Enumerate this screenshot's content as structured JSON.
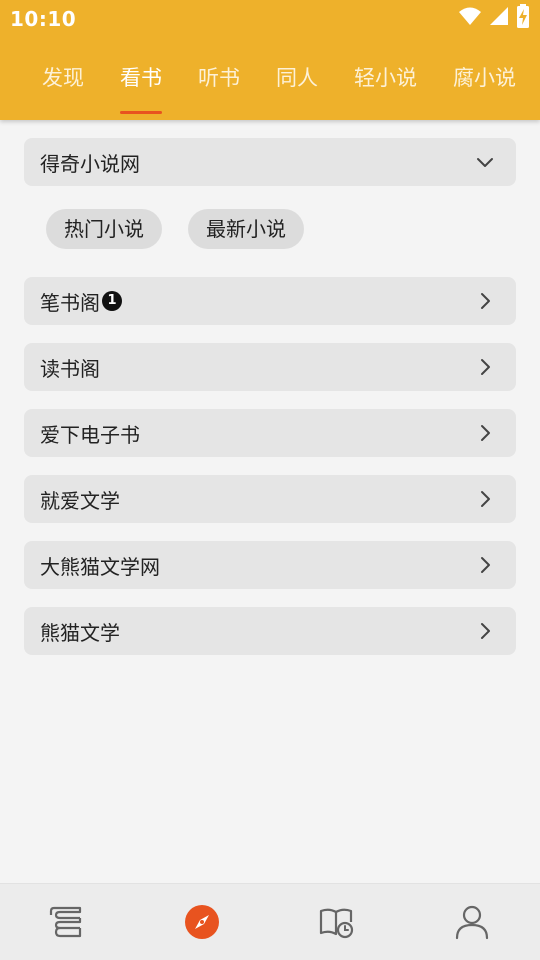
{
  "status_bar": {
    "time": "10:10",
    "icons": [
      "wifi-icon",
      "signal-icon",
      "battery-charging-icon"
    ]
  },
  "tabs": [
    {
      "label": "发现",
      "active": false
    },
    {
      "label": "看书",
      "active": true
    },
    {
      "label": "听书",
      "active": false
    },
    {
      "label": "同人",
      "active": false
    },
    {
      "label": "轻小说",
      "active": false
    },
    {
      "label": "腐小说",
      "active": false
    }
  ],
  "source_select": {
    "value": "得奇小说网",
    "icon": "chevron-down-icon"
  },
  "chips": [
    {
      "label": "热门小说"
    },
    {
      "label": "最新小说"
    }
  ],
  "sources": [
    {
      "label": "笔书阁",
      "badge": "1"
    },
    {
      "label": "读书阁"
    },
    {
      "label": "爱下电子书"
    },
    {
      "label": "就爱文学"
    },
    {
      "label": "大熊猫文学网"
    },
    {
      "label": "熊猫文学"
    }
  ],
  "bottom_nav": [
    {
      "icon": "bookshelf-icon",
      "active": false
    },
    {
      "icon": "compass-icon",
      "active": true
    },
    {
      "icon": "history-book-icon",
      "active": false
    },
    {
      "icon": "profile-icon",
      "active": false
    }
  ],
  "colors": {
    "header": "#eeb12b",
    "accent": "#e8531f",
    "background": "#f4f4f4",
    "item_background": "#e5e5e5"
  }
}
